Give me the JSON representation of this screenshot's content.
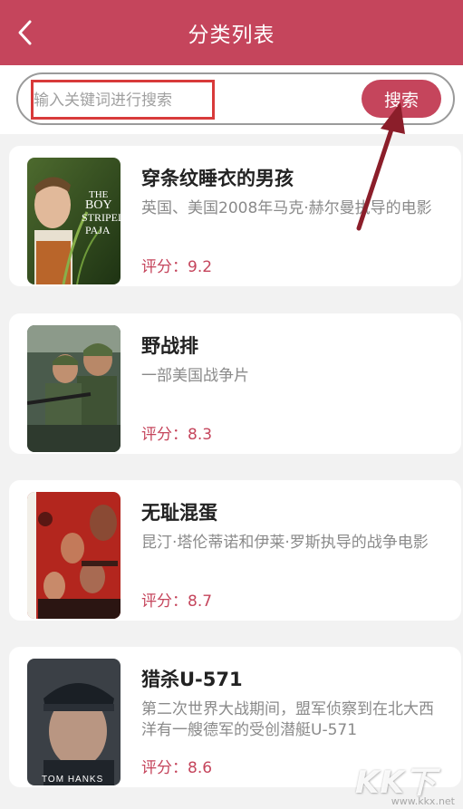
{
  "header": {
    "title": "分类列表",
    "back_icon": "chevron-left-icon"
  },
  "search": {
    "placeholder": "输入关键词进行搜索",
    "value": "",
    "button_label": "搜索"
  },
  "movies": [
    {
      "title": "穿条纹睡衣的男孩",
      "desc": "英国、美国2008年马克·赫尔曼执导的电影",
      "rating": "评分：9.2",
      "poster_text": "THE BOY IN THE STRIPED PAJAMAS"
    },
    {
      "title": "野战排",
      "desc": "一部美国战争片",
      "rating": "评分：8.3"
    },
    {
      "title": "无耻混蛋",
      "desc": "昆汀·塔伦蒂诺和伊莱·罗斯执导的战争电影",
      "rating": "评分：8.7"
    },
    {
      "title": "猎杀U-571",
      "desc": "第二次世界大战期间，盟军侦察到在北大西洋有一艘德军的受创潜艇U-571",
      "rating": "评分：8.6",
      "poster_text": "TOM HANKS"
    }
  ],
  "watermark": {
    "logo": "KK下载",
    "url": "www.kkx.net"
  },
  "colors": {
    "brand": "#c5455c",
    "annotation": "#d83a3a",
    "background": "#f2f2f2"
  }
}
